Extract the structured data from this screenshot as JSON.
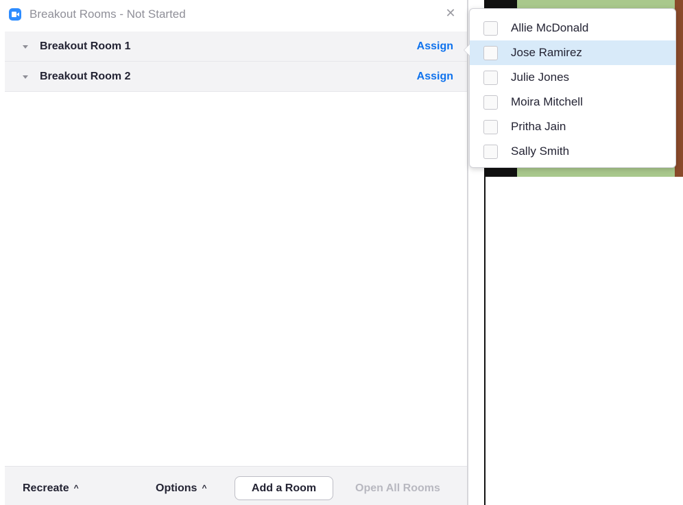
{
  "window": {
    "title": "Breakout Rooms - Not Started",
    "close_glyph": "✕"
  },
  "rooms": [
    {
      "name": "Breakout Room 1",
      "assign_label": "Assign"
    },
    {
      "name": "Breakout Room 2",
      "assign_label": "Assign"
    }
  ],
  "footer": {
    "recreate_label": "Recreate",
    "options_label": "Options",
    "add_room_label": "Add a Room",
    "open_all_label": "Open All Rooms",
    "chevron_glyph": "^"
  },
  "assign_popup": {
    "participants": [
      {
        "name": "Allie McDonald",
        "checked": false,
        "highlighted": false
      },
      {
        "name": "Jose Ramirez",
        "checked": false,
        "highlighted": true
      },
      {
        "name": "Julie Jones",
        "checked": false,
        "highlighted": false
      },
      {
        "name": "Moira Mitchell",
        "checked": false,
        "highlighted": false
      },
      {
        "name": "Pritha Jain",
        "checked": false,
        "highlighted": false
      },
      {
        "name": "Sally Smith",
        "checked": false,
        "highlighted": false
      }
    ]
  },
  "colors": {
    "accent": "#0e72ed",
    "app_icon": "#2d8cff",
    "highlight_row": "#d8eaf9",
    "disabled_text": "#b8b8c0"
  },
  "icons": {
    "app": "zoom-camera-icon",
    "close": "close-icon",
    "caret": "caret-down-icon",
    "chevron": "chevron-up-icon"
  }
}
